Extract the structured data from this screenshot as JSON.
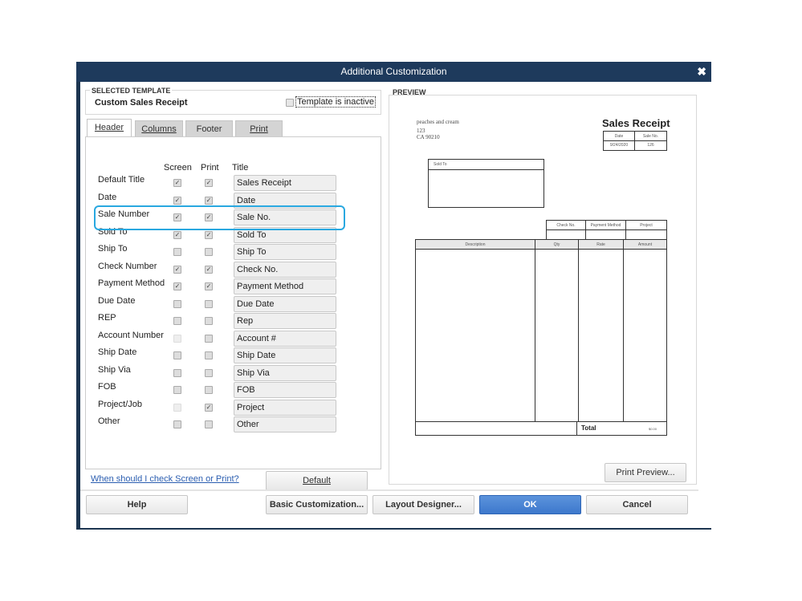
{
  "window": {
    "title": "Additional Customization",
    "close_icon": "close-icon"
  },
  "selected_template": {
    "label": "SELECTED TEMPLATE",
    "name": "Custom Sales Receipt",
    "inactive_label": "Template is inactive",
    "inactive_checked": false
  },
  "tabs": [
    {
      "label": "Header",
      "active": true
    },
    {
      "label": "Columns"
    },
    {
      "label": "Footer"
    },
    {
      "label": "Print"
    }
  ],
  "columns": {
    "screen": "Screen",
    "print": "Print",
    "title": "Title"
  },
  "rows": [
    {
      "label": "Default Title",
      "screen": true,
      "print": true,
      "title": "Sales Receipt"
    },
    {
      "label": "Date",
      "screen": true,
      "print": true,
      "title": "Date"
    },
    {
      "label": "Sale Number",
      "screen": true,
      "print": true,
      "title": "Sale No.",
      "highlighted": true
    },
    {
      "label": "Sold To",
      "screen": true,
      "print": true,
      "title": "Sold To"
    },
    {
      "label": "Ship To",
      "screen": false,
      "print": false,
      "title": "Ship To"
    },
    {
      "label": "Check Number",
      "screen": true,
      "print": true,
      "title": "Check No."
    },
    {
      "label": "Payment Method",
      "screen": true,
      "print": true,
      "title": "Payment Method"
    },
    {
      "label": "Due Date",
      "screen": false,
      "print": false,
      "title": "Due Date"
    },
    {
      "label": "REP",
      "screen": false,
      "print": false,
      "title": "Rep"
    },
    {
      "label": "Account Number",
      "screen": false,
      "screen_disabled": true,
      "print": false,
      "title": "Account #"
    },
    {
      "label": "Ship Date",
      "screen": false,
      "print": false,
      "title": "Ship Date"
    },
    {
      "label": "Ship Via",
      "screen": false,
      "print": false,
      "title": "Ship Via"
    },
    {
      "label": "FOB",
      "screen": false,
      "print": false,
      "title": "FOB"
    },
    {
      "label": "Project/Job",
      "screen": false,
      "screen_disabled": true,
      "print": true,
      "title": "Project"
    },
    {
      "label": "Other",
      "screen": false,
      "print": false,
      "title": "Other"
    }
  ],
  "help_link": "When should I check Screen or Print?",
  "preview": {
    "label": "PREVIEW",
    "company": "peaches and cream",
    "address1": "123",
    "address2": "CA 90210",
    "doc_title": "Sales Receipt",
    "date_header": "Date",
    "saleno_header": "Sale No.",
    "date": "9/24/2020",
    "saleno": "126",
    "sold_to": "Sold To",
    "check_no": "Check No.",
    "payment_method": "Payment Method",
    "project": "Project",
    "items_headers": [
      "Description",
      "Qty",
      "Rate",
      "Amount"
    ],
    "total_label": "Total",
    "total_value": "$0.00"
  },
  "buttons": {
    "default": "Default",
    "print_preview": "Print Preview...",
    "help": "Help",
    "basic": "Basic Customization...",
    "layout": "Layout Designer...",
    "ok": "OK",
    "cancel": "Cancel"
  },
  "colors": {
    "titlebar": "#1e3a5c",
    "highlight": "#29a8e0",
    "ok": "#3d78cc",
    "link": "#2a5db0"
  }
}
